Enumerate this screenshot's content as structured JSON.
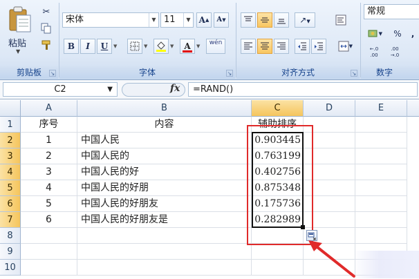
{
  "ribbon": {
    "clipboard": {
      "paste_label": "粘贴",
      "group_label": "剪贴板"
    },
    "font": {
      "font_name": "宋体",
      "font_size": "11",
      "bold": "B",
      "italic": "I",
      "underline": "U",
      "grow_font": "A",
      "shrink_font": "A",
      "font_color_glyph": "A",
      "phonetic_glyph": "wén",
      "group_label": "字体"
    },
    "alignment": {
      "group_label": "对齐方式"
    },
    "number": {
      "format_value": "常规",
      "percent": "%",
      "comma": ",",
      "group_label": "数字"
    }
  },
  "formula_bar": {
    "name_box": "C2",
    "fx": "fx",
    "formula": "=RAND()"
  },
  "sheet": {
    "corner": "",
    "columns": [
      "A",
      "B",
      "C",
      "D",
      "E"
    ],
    "rows": [
      "1",
      "2",
      "3",
      "4",
      "5",
      "6",
      "7",
      "8",
      "9",
      "10"
    ],
    "header_row": {
      "a": "序号",
      "b": "内容",
      "c": "辅助排序"
    },
    "data": [
      {
        "a": "1",
        "b": "中国人民",
        "c": "0.903445"
      },
      {
        "a": "2",
        "b": "中国人民的",
        "c": "0.763199"
      },
      {
        "a": "3",
        "b": "中国人民的好",
        "c": "0.402756"
      },
      {
        "a": "4",
        "b": "中国人民的好朋",
        "c": "0.875348"
      },
      {
        "a": "5",
        "b": "中国人民的好朋友",
        "c": "0.175736"
      },
      {
        "a": "6",
        "b": "中国人民的好朋友是",
        "c": "0.282989"
      }
    ]
  },
  "colors": {
    "ribbon_label": "#15428b",
    "selection_header": "#f5c55d",
    "annotation_red": "#e02a2a"
  }
}
